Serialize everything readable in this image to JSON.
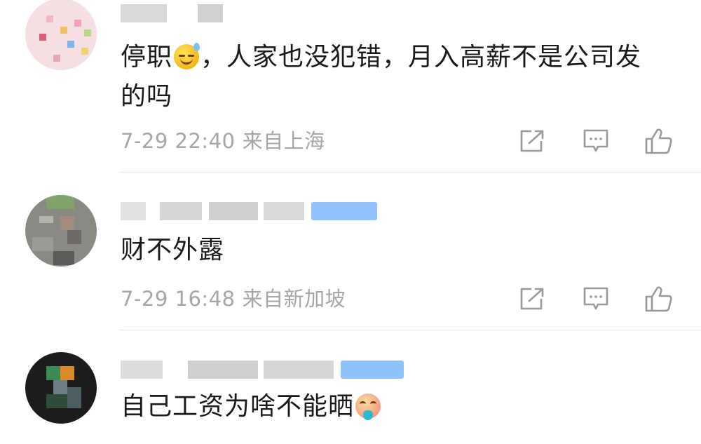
{
  "comments": [
    {
      "text_segments": [
        "停职",
        "，人家也没犯错，月入高薪不是公司发的吗"
      ],
      "time": "7-29 22:40",
      "location": "来自上海",
      "emoji": "sweat-smile-emoji",
      "actions": [
        "share-icon",
        "comment-icon",
        "like-icon"
      ]
    },
    {
      "text_segments": [
        "财不外露",
        ""
      ],
      "time": "7-29 16:48",
      "location": "来自新加坡",
      "emoji": "",
      "actions": [
        "share-icon",
        "comment-icon",
        "like-icon"
      ]
    },
    {
      "text_segments": [
        "自己工资为啥不能晒",
        ""
      ],
      "time": "",
      "location": "",
      "emoji": "vomit-emoji",
      "actions": []
    }
  ],
  "colors": {
    "text": "#1a1a1a",
    "meta": "#a6a6a6",
    "divider": "#e8e8e8",
    "icon": "#9a9a9a",
    "vip_badge": "#8fc2ff"
  }
}
